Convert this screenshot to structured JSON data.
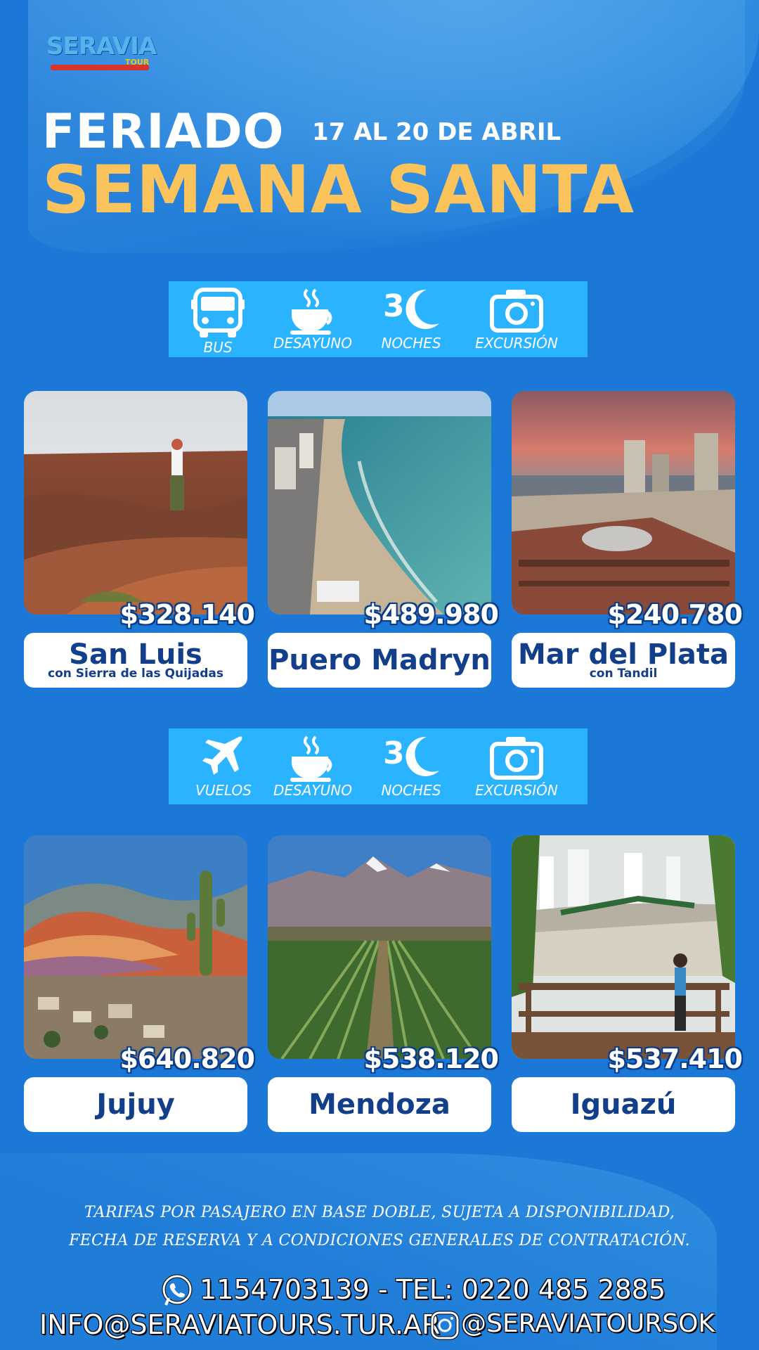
{
  "brand": {
    "logo_text": "SERAVIA",
    "logo_sub": "TOUR",
    "colors": {
      "background": "#1b78d6",
      "accent": "#fbc35c",
      "bar": "#2ab3ff",
      "label_text": "#123e8a"
    }
  },
  "header": {
    "line1": "FERIADO",
    "dates": "17 AL 20 DE ABRIL",
    "line2": "SEMANA SANTA"
  },
  "bus_section": {
    "features": [
      {
        "icon": "bus-icon",
        "label": "BUS"
      },
      {
        "icon": "coffee-cup-icon",
        "label": "DESAYUNO"
      },
      {
        "icon": "moon-icon",
        "number": "3",
        "label": "NOCHES"
      },
      {
        "icon": "camera-icon",
        "label": "EXCURSIÓN"
      }
    ],
    "destinations": [
      {
        "name": "San Luis",
        "subtitle": "con Sierra de las Quijadas",
        "price": "$328.140"
      },
      {
        "name": "Puero Madryn",
        "subtitle": "",
        "price": "$489.980"
      },
      {
        "name": "Mar del Plata",
        "subtitle": "con Tandil",
        "price": "$240.780"
      }
    ]
  },
  "flight_section": {
    "features": [
      {
        "icon": "airplane-icon",
        "label": "VUELOS"
      },
      {
        "icon": "coffee-cup-icon",
        "label": "DESAYUNO"
      },
      {
        "icon": "moon-icon",
        "number": "3",
        "label": "NOCHES"
      },
      {
        "icon": "camera-icon",
        "label": "EXCURSIÓN"
      }
    ],
    "destinations": [
      {
        "name": "Jujuy",
        "subtitle": "",
        "price": "$640.820"
      },
      {
        "name": "Mendoza",
        "subtitle": "",
        "price": "$538.120"
      },
      {
        "name": "Iguazú",
        "subtitle": "",
        "price": "$537.410"
      }
    ]
  },
  "footer": {
    "disclaimer_line1": "TARIFAS POR PASAJERO EN BASE DOBLE, SUJETA A DISPONIBILIDAD,",
    "disclaimer_line2": "FECHA DE RESERVA Y A CONDICIONES GENERALES DE CONTRATACIÓN.",
    "phone": "1154703139 - TEL: 0220 485 2885",
    "email": "INFO@SERAVIATOURS.TUR.AR",
    "instagram": "@SERAVIATOURSOK"
  }
}
